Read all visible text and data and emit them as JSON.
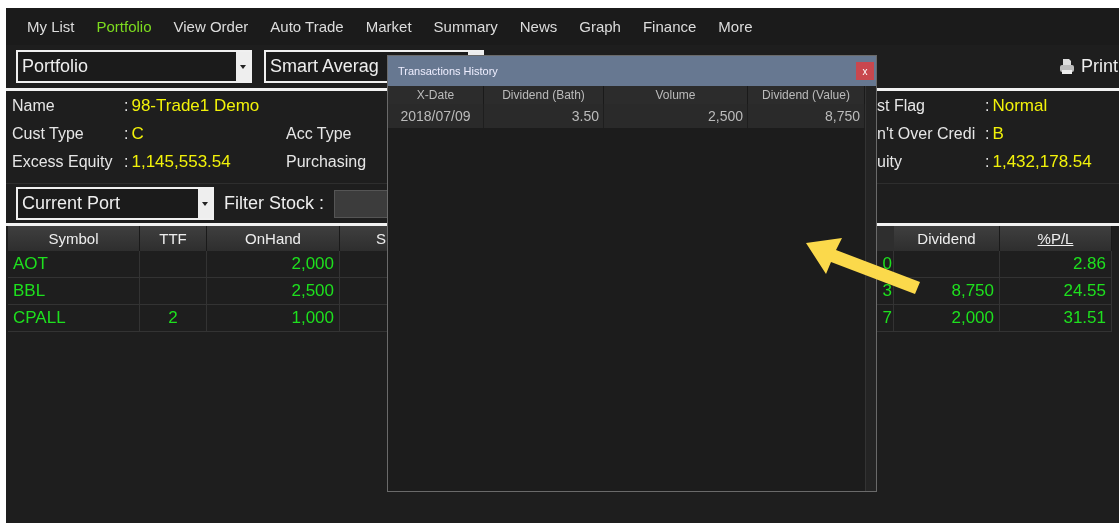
{
  "menu": [
    {
      "label": "My List",
      "selected": false
    },
    {
      "label": "Portfolio",
      "selected": true
    },
    {
      "label": "View Order",
      "selected": false
    },
    {
      "label": "Auto Trade",
      "selected": false
    },
    {
      "label": "Market",
      "selected": false
    },
    {
      "label": "Summary",
      "selected": false
    },
    {
      "label": "News",
      "selected": false
    },
    {
      "label": "Graph",
      "selected": false
    },
    {
      "label": "Finance",
      "selected": false
    },
    {
      "label": "More",
      "selected": false
    }
  ],
  "toolbar": {
    "portfolio_select": "Portfolio",
    "average_select": "Smart Averag",
    "print_button": "Print"
  },
  "account_left": [
    {
      "label": "Name",
      "colon": ":",
      "value": "98-Trade1 Demo"
    },
    {
      "label": "Cust Type",
      "colon": ":",
      "value": "C"
    },
    {
      "label": "Excess Equity",
      "colon": ":",
      "value": "1,145,553.54"
    }
  ],
  "account_middle": [
    {
      "label": "Acc Type"
    },
    {
      "label": "Purchasing"
    }
  ],
  "account_right": [
    {
      "label": "st Flag",
      "colon": ":",
      "value": "Normal"
    },
    {
      "label": "n't Over Credi",
      "colon": ":",
      "value": "B"
    },
    {
      "label": "uity",
      "colon": ":",
      "value": "1,432,178.54"
    }
  ],
  "filter": {
    "port_select": "Current Port",
    "label": "Filter Stock :"
  },
  "table": {
    "columns": [
      {
        "label": "Symbol",
        "sorted": false
      },
      {
        "label": "TTF",
        "sorted": false
      },
      {
        "label": "OnHand",
        "sorted": false
      },
      {
        "label": "S",
        "sorted": false
      },
      {
        "label": "Dividend",
        "sorted": false
      },
      {
        "label": "%P/L",
        "sorted": true
      }
    ],
    "rows": [
      {
        "symbol": "AOT",
        "onhand": "2,000",
        "column_5": "0",
        "pl": "2.86"
      },
      {
        "symbol": "BBL",
        "onhand": "2,500",
        "column_5": "3",
        "dividend": "8,750",
        "pl": "24.55"
      },
      {
        "symbol": "CPALL",
        "ttf": "2",
        "onhand": "1,000",
        "column_5": "7",
        "dividend": "2,000",
        "pl": "31.51"
      }
    ]
  },
  "dialog": {
    "title": "Transactions History",
    "close": "x",
    "columns": [
      "X-Date",
      "Dividend (Bath)",
      "Volume",
      "Dividend (Value)"
    ],
    "rows": [
      [
        "2018/07/09",
        "3.50",
        "2,500",
        "8,750"
      ]
    ]
  }
}
